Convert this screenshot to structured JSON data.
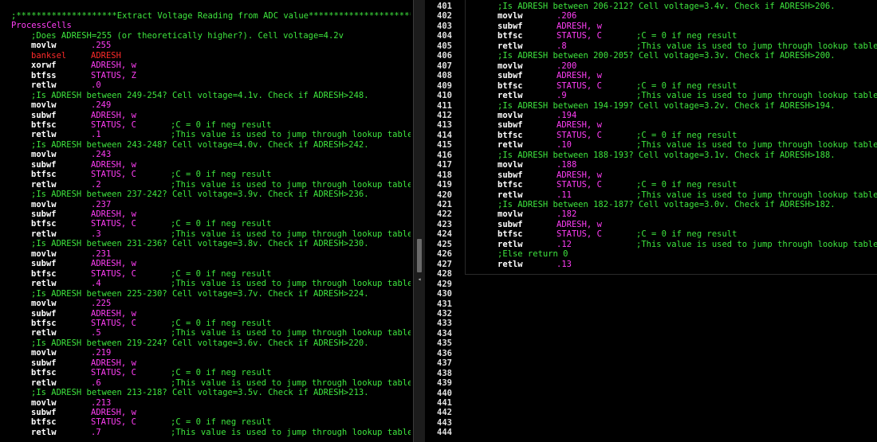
{
  "left_lines": [
    {
      "t": "comment",
      "indent": 1,
      "c": ";********************Extract Voltage Reading from ADC value************************"
    },
    {
      "t": "label",
      "text": "ProcessCells"
    },
    {
      "t": "comment",
      "indent": 3,
      "c": ";Does ADRESH=255 (or theoretically higher?). Cell voltage=4.2v"
    },
    {
      "t": "instr",
      "m": "movlw",
      "o": ".255"
    },
    {
      "t": "instr",
      "m": "banksel",
      "o": "ADRESH",
      "red": true
    },
    {
      "t": "instr",
      "m": "xorwf",
      "o": "ADRESH, w"
    },
    {
      "t": "instr",
      "m": "btfss",
      "o": "STATUS, Z"
    },
    {
      "t": "instr",
      "m": "retlw",
      "o": ".0"
    },
    {
      "t": "comment",
      "indent": 3,
      "c": ";Is ADRESH between 249-254? Cell voltage=4.1v. Check if ADRESH>248."
    },
    {
      "t": "instr",
      "m": "movlw",
      "o": ".249"
    },
    {
      "t": "instr",
      "m": "subwf",
      "o": "ADRESH, w"
    },
    {
      "t": "instr",
      "m": "btfsc",
      "o": "STATUS, C",
      "c": ";C = 0 if neg result"
    },
    {
      "t": "instr",
      "m": "retlw",
      "o": ".1",
      "c": ";This value is used to jump through lookup table"
    },
    {
      "t": "comment",
      "indent": 3,
      "c": ";Is ADRESH between 243-248? Cell voltage=4.0v. Check if ADRESH>242."
    },
    {
      "t": "instr",
      "m": "movlw",
      "o": ".243"
    },
    {
      "t": "instr",
      "m": "subwf",
      "o": "ADRESH, w"
    },
    {
      "t": "instr",
      "m": "btfsc",
      "o": "STATUS, C",
      "c": ";C = 0 if neg result"
    },
    {
      "t": "instr",
      "m": "retlw",
      "o": ".2",
      "c": ";This value is used to jump through lookup table"
    },
    {
      "t": "comment",
      "indent": 3,
      "c": ";Is ADRESH between 237-242? Cell voltage=3.9v. Check if ADRESH>236."
    },
    {
      "t": "instr",
      "m": "movlw",
      "o": ".237"
    },
    {
      "t": "instr",
      "m": "subwf",
      "o": "ADRESH, w"
    },
    {
      "t": "instr",
      "m": "btfsc",
      "o": "STATUS, C",
      "c": ";C = 0 if neg result"
    },
    {
      "t": "instr",
      "m": "retlw",
      "o": ".3",
      "c": ";This value is used to jump through lookup table"
    },
    {
      "t": "comment",
      "indent": 3,
      "c": ";Is ADRESH between 231-236? Cell voltage=3.8v. Check if ADRESH>230."
    },
    {
      "t": "instr",
      "m": "movlw",
      "o": ".231"
    },
    {
      "t": "instr",
      "m": "subwf",
      "o": "ADRESH, w"
    },
    {
      "t": "instr",
      "m": "btfsc",
      "o": "STATUS, C",
      "c": ";C = 0 if neg result"
    },
    {
      "t": "instr",
      "m": "retlw",
      "o": ".4",
      "c": ";This value is used to jump through lookup table"
    },
    {
      "t": "comment",
      "indent": 3,
      "c": ";Is ADRESH between 225-230? Cell voltage=3.7v. Check if ADRESH>224."
    },
    {
      "t": "instr",
      "m": "movlw",
      "o": ".225"
    },
    {
      "t": "instr",
      "m": "subwf",
      "o": "ADRESH, w"
    },
    {
      "t": "instr",
      "m": "btfsc",
      "o": "STATUS, C",
      "c": ";C = 0 if neg result"
    },
    {
      "t": "instr",
      "m": "retlw",
      "o": ".5",
      "c": ";This value is used to jump through lookup table"
    },
    {
      "t": "comment",
      "indent": 3,
      "c": ";Is ADRESH between 219-224? Cell voltage=3.6v. Check if ADRESH>220."
    },
    {
      "t": "instr",
      "m": "movlw",
      "o": ".219"
    },
    {
      "t": "instr",
      "m": "subwf",
      "o": "ADRESH, w"
    },
    {
      "t": "instr",
      "m": "btfsc",
      "o": "STATUS, C",
      "c": ";C = 0 if neg result"
    },
    {
      "t": "instr",
      "m": "retlw",
      "o": ".6",
      "c": ";This value is used to jump through lookup table"
    },
    {
      "t": "comment",
      "indent": 3,
      "c": ";Is ADRESH between 213-218? Cell voltage=3.5v. Check if ADRESH>213."
    },
    {
      "t": "instr",
      "m": "movlw",
      "o": ".213"
    },
    {
      "t": "instr",
      "m": "subwf",
      "o": "ADRESH, w"
    },
    {
      "t": "instr",
      "m": "btfsc",
      "o": "STATUS, C",
      "c": ";C = 0 if neg result"
    },
    {
      "t": "instr",
      "m": "retlw",
      "o": ".7",
      "c": ";This value is used to jump through lookup table"
    }
  ],
  "gutter_numbers": [
    "401",
    "402",
    "403",
    "404",
    "405",
    "406",
    "407",
    "408",
    "409",
    "410",
    "411",
    "412",
    "413",
    "414",
    "415",
    "416",
    "417",
    "418",
    "419",
    "420",
    "421",
    "422",
    "423",
    "424",
    "425",
    "426",
    "427",
    "428",
    "429",
    "430",
    "431",
    "432",
    "433",
    "434",
    "435",
    "436",
    "437",
    "438",
    "439",
    "440",
    "441",
    "442",
    "443",
    "444"
  ],
  "right_lines": [
    {
      "t": "comment",
      "indent": 0,
      "c": ";Is ADRESH between 206-212? Cell voltage=3.4v. Check if ADRESH>206."
    },
    {
      "t": "instr",
      "m": "movlw",
      "o": ".206"
    },
    {
      "t": "instr",
      "m": "subwf",
      "o": "ADRESH, w"
    },
    {
      "t": "instr",
      "m": "btfsc",
      "o": "STATUS, C",
      "c": ";C = 0 if neg result"
    },
    {
      "t": "instr",
      "m": "retlw",
      "o": ".8",
      "c": ";This value is used to jump through lookup table"
    },
    {
      "t": "comment",
      "indent": 0,
      "c": ";Is ADRESH between 200-205? Cell voltage=3.3v. Check if ADRESH>200."
    },
    {
      "t": "instr",
      "m": "movlw",
      "o": ".200"
    },
    {
      "t": "instr",
      "m": "subwf",
      "o": "ADRESH, w"
    },
    {
      "t": "instr",
      "m": "btfsc",
      "o": "STATUS, C",
      "c": ";C = 0 if neg result"
    },
    {
      "t": "instr",
      "m": "retlw",
      "o": ".9",
      "c": ";This value is used to jump through lookup table"
    },
    {
      "t": "comment",
      "indent": 0,
      "c": ";Is ADRESH between 194-199? Cell voltage=3.2v. Check if ADRESH>194."
    },
    {
      "t": "instr",
      "m": "movlw",
      "o": ".194"
    },
    {
      "t": "instr",
      "m": "subwf",
      "o": "ADRESH, w"
    },
    {
      "t": "instr",
      "m": "btfsc",
      "o": "STATUS, C",
      "c": ";C = 0 if neg result"
    },
    {
      "t": "instr",
      "m": "retlw",
      "o": ".10",
      "c": ";This value is used to jump through lookup table"
    },
    {
      "t": "comment",
      "indent": 0,
      "c": ";Is ADRESH between 188-193? Cell voltage=3.1v. Check if ADRESH>188."
    },
    {
      "t": "instr",
      "m": "movlw",
      "o": ".188"
    },
    {
      "t": "instr",
      "m": "subwf",
      "o": "ADRESH, w"
    },
    {
      "t": "instr",
      "m": "btfsc",
      "o": "STATUS, C",
      "c": ";C = 0 if neg result"
    },
    {
      "t": "instr",
      "m": "retlw",
      "o": ".11",
      "c": ";This value is used to jump through lookup table"
    },
    {
      "t": "comment",
      "indent": 0,
      "c": ";Is ADRESH between 182-187? Cell voltage=3.0v. Check if ADRESH>182."
    },
    {
      "t": "instr",
      "m": "movlw",
      "o": ".182"
    },
    {
      "t": "instr",
      "m": "subwf",
      "o": "ADRESH, w"
    },
    {
      "t": "instr",
      "m": "btfsc",
      "o": "STATUS, C",
      "c": ";C = 0 if neg result"
    },
    {
      "t": "instr",
      "m": "retlw",
      "o": ".12",
      "c": ";This value is used to jump through lookup table"
    },
    {
      "t": "comment",
      "indent": 0,
      "c": ";Else return 0"
    },
    {
      "t": "instr",
      "m": "retlw",
      "o": ".13"
    }
  ],
  "colors": {
    "background": "#000000",
    "comment": "#3ee63e",
    "mnemonic": "#ffffff",
    "operand": "#ff3ef5",
    "banksel": "#ff2a2a"
  }
}
